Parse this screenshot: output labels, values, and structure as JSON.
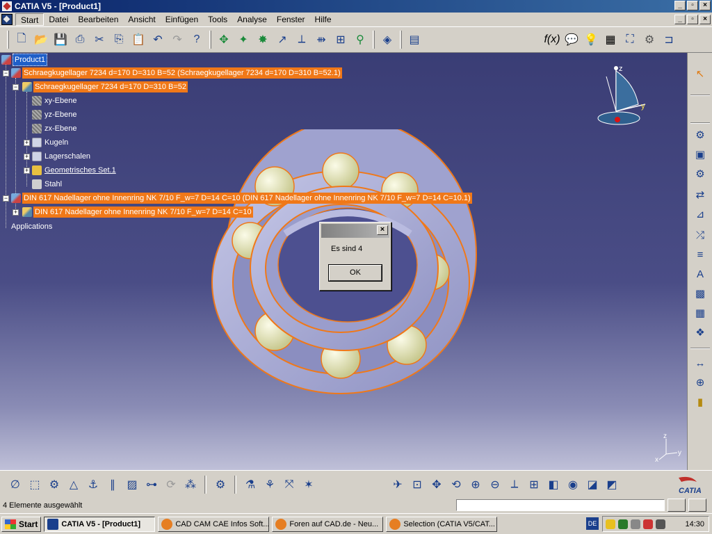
{
  "window": {
    "title": "CATIA V5 - [Product1]"
  },
  "menu": {
    "items": [
      "Start",
      "Datei",
      "Bearbeiten",
      "Ansicht",
      "Einfügen",
      "Tools",
      "Analyse",
      "Fenster",
      "Hilfe"
    ],
    "active": "Start"
  },
  "tree": {
    "root": "Product1",
    "n1": "Schraegkugellager 7234 d=170 D=310 B=52 (Schraegkugellager 7234 d=170 D=310 B=52.1)",
    "n1a": "Schraegkugellager 7234 d=170 D=310 B=52",
    "n1a1": "xy-Ebene",
    "n1a2": "yz-Ebene",
    "n1a3": "zx-Ebene",
    "n1a4": "Kugeln",
    "n1a5": "Lagerschalen",
    "n1a6": "Geometrisches Set.1",
    "n1a7": "Stahl",
    "n2": "DIN 617 Nadellager ohne Innenring NK 7/10 F_w=7 D=14 C=10 (DIN 617 Nadellager ohne Innenring NK 7/10 F_w=7 D=14 C=10.1)",
    "n2a": "DIN 617 Nadellager ohne Innenring NK 7/10 F_w=7 D=14 C=10",
    "apps": "Applications"
  },
  "compass": {
    "x": "x",
    "y": "y",
    "z": "z"
  },
  "dialog": {
    "message": "Es sind 4",
    "ok": "OK",
    "close": "×"
  },
  "status": {
    "text": "4 Elemente ausgewählt"
  },
  "taskbar": {
    "start": "Start",
    "tasks": [
      "CATIA V5 - [Product1]",
      "CAD CAM CAE Infos Soft...",
      "Foren auf CAD.de - Neu...",
      "Selection (CATIA V5/CAT..."
    ],
    "lang": "DE",
    "clock": "14:30"
  },
  "logo": {
    "text": "CATIA"
  },
  "colors": {
    "selection": "#f07818",
    "viewport_top": "#3a3d75",
    "title_bar": "#0a246a"
  },
  "icons": {
    "top": [
      "new-icon",
      "open-icon",
      "save-icon",
      "print-icon",
      "cut-icon",
      "copy-icon",
      "paste-icon",
      "undo-icon",
      "redo-icon",
      "whatsthis-icon",
      "move-icon",
      "snap-icon",
      "explode-icon",
      "manipulate-icon",
      "constraint-icon",
      "coincidence-icon",
      "contact-icon",
      "fix-icon",
      "catalog-icon",
      "bom-icon",
      "formula-icon",
      "knowledge-icon",
      "light-icon",
      "table-icon",
      "graph-icon",
      "plugin-icon",
      "macro-icon"
    ],
    "right": [
      "select-icon",
      "component-icon",
      "product-icon",
      "part-icon",
      "replace-icon",
      "graph-tree-icon",
      "reorder-icon",
      "numbering-icon",
      "fast-multi-icon",
      "reuse-pattern-icon",
      "manage-rep-icon",
      "scene-icon",
      "measure-icon",
      "weld-icon",
      "bottle-icon"
    ],
    "bottom": [
      "sketch-icon",
      "pad-icon",
      "cam-icon",
      "analysis-icon",
      "ruler-icon",
      "link-icon",
      "frame-icon",
      "section-icon",
      "sweep-icon",
      "bolt-icon",
      "gear-icon",
      "catalog-b-icon",
      "fly-icon",
      "fit-all-icon",
      "pan-icon",
      "rotate-icon",
      "zoom-in-icon",
      "zoom-out-icon",
      "normal-view-icon",
      "multi-view-icon",
      "iso-view-icon",
      "shading-icon",
      "hide-show-icon",
      "swap-icon"
    ]
  }
}
